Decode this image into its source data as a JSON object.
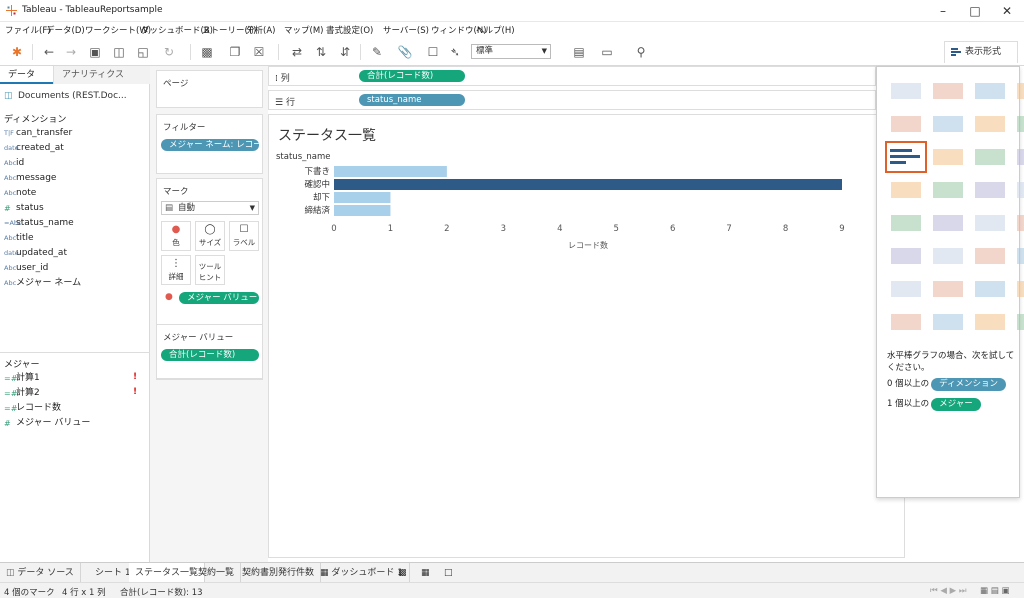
{
  "window": {
    "title": "Tableau - TableauReportsample"
  },
  "menu": [
    "ファイル(F)",
    "データ(D)",
    "ワークシート(W)",
    "ダッシュボード(B)",
    "ストーリー(T)",
    "分析(A)",
    "マップ(M)",
    "書式設定(O)",
    "サーバー(S)",
    "ウィンドウ(N)",
    "ヘルプ(H)"
  ],
  "toolbar": {
    "fit": "標準",
    "showme_label": "表示形式"
  },
  "data_pane": {
    "tabs": [
      "データ",
      "アナリティクス"
    ],
    "datasource": "Documents (REST.Doc...",
    "dimensions_title": "ディメンション",
    "dimensions": [
      {
        "type": "T|F",
        "name": "can_transfer"
      },
      {
        "type": "date",
        "name": "created_at"
      },
      {
        "type": "Abc",
        "name": "id"
      },
      {
        "type": "Abc",
        "name": "message"
      },
      {
        "type": "Abc",
        "name": "note"
      },
      {
        "type": "#",
        "name": "status"
      },
      {
        "type": "=Abc",
        "name": "status_name"
      },
      {
        "type": "Abc",
        "name": "title"
      },
      {
        "type": "date",
        "name": "updated_at"
      },
      {
        "type": "Abc",
        "name": "user_id"
      },
      {
        "type": "Abc",
        "name": "メジャー ネーム"
      }
    ],
    "measures_title": "メジャー",
    "measures": [
      {
        "type": "=#",
        "name": "計算1",
        "warn": "!"
      },
      {
        "type": "=#",
        "name": "計算2",
        "warn": "!"
      },
      {
        "type": "=#",
        "name": "レコード数",
        "warn": ""
      },
      {
        "type": "#",
        "name": "メジャー バリュー",
        "warn": ""
      }
    ]
  },
  "shelves": {
    "pages": "ページ",
    "filters_title": "フィルター",
    "filter_pill": "メジャー ネーム: レコード..",
    "marks_title": "マーク",
    "mark_type": "自動",
    "mark_buttons": [
      "色",
      "サイズ",
      "ラベル",
      "詳細",
      "ツール ヒント"
    ],
    "marks_pill": "メジャー バリュー",
    "measure_values_title": "メジャー バリュー",
    "measure_values_pill": "合計(レコード数)",
    "columns_label": "列",
    "columns_pill": "合計(レコード数)",
    "rows_label": "行",
    "rows_pill": "status_name"
  },
  "worksheet": {
    "title": "ステータス一覧"
  },
  "chart_data": {
    "type": "bar",
    "orientation": "horizontal",
    "row_header": "status_name",
    "categories": [
      "下書き",
      "確認中",
      "却下",
      "締結済"
    ],
    "values": [
      2,
      9,
      1,
      1
    ],
    "xlabel": "レコード数",
    "xlim": [
      0,
      9
    ],
    "xticks": [
      0,
      1,
      2,
      3,
      4,
      5,
      6,
      7,
      8,
      9
    ],
    "colors": [
      "#a8d0ea",
      "#2e5a87",
      "#a8d0ea",
      "#a8d0ea"
    ]
  },
  "showme": {
    "hint": "水平棒グラフの場合、次を試してください。",
    "req1_prefix": "0 個以上の",
    "req1_pill": "ディメンション",
    "req2_prefix": "1 個以上の",
    "req2_pill": "メジャー"
  },
  "sheet_tabs": [
    "データ ソース",
    "シート 1",
    "ステータス一覧",
    "契約一覧",
    "契約書別発行件数",
    "ダッシュボード 1"
  ],
  "status": {
    "marks": "4 個のマーク",
    "grid": "4 行 x 1 列",
    "sum": "合計(レコード数): 13"
  }
}
